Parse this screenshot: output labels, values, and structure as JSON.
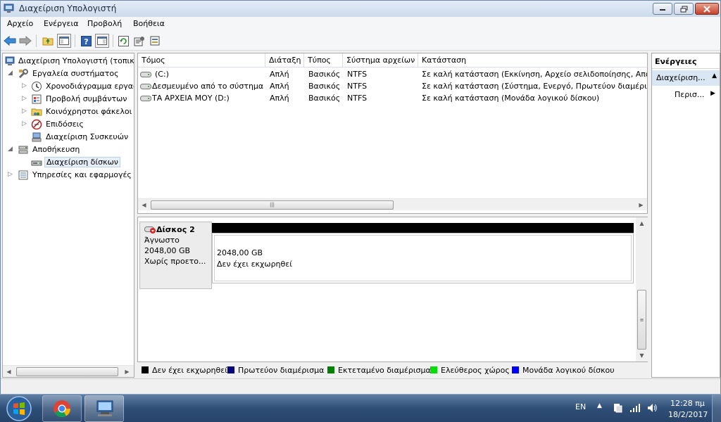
{
  "window": {
    "title": "Διαχείριση Υπολογιστή"
  },
  "menubar": {
    "items": [
      "Αρχείο",
      "Ενέργεια",
      "Προβολή",
      "Βοήθεια"
    ]
  },
  "tree": {
    "root": "Διαχείριση Υπολογιστή (τοπικ",
    "system_tools": "Εργαλεία συστήματος",
    "task_scheduler": "Χρονοδιάγραμμα εργασ",
    "event_viewer": "Προβολή συμβάντων",
    "shared_folders": "Κοινόχρηστοι φάκελοι",
    "performance": "Επιδόσεις",
    "device_manager": "Διαχείριση Συσκευών",
    "storage": "Αποθήκευση",
    "disk_management": "Διαχείριση δίσκων",
    "services": "Υπηρεσίες και εφαρμογές"
  },
  "volumes": {
    "columns": [
      "Τόμος",
      "Διάταξη",
      "Τύπος",
      "Σύστημα αρχείων",
      "Κατάσταση"
    ],
    "rows": [
      {
        "volume": "(C:)",
        "layout": "Απλή",
        "type": "Βασικός",
        "fs": "NTFS",
        "status": "Σε καλή κατάσταση (Εκκίνηση, Αρχείο σελιδοποίησης, Αποτ"
      },
      {
        "volume": "Δεσμευμένο από το σύστημα",
        "layout": "Απλή",
        "type": "Βασικός",
        "fs": "NTFS",
        "status": "Σε καλή κατάσταση (Σύστημα, Ενεργό, Πρωτεύον διαμέρισμ"
      },
      {
        "volume": "ΤΑ ΑΡΧΕΙΑ ΜΟΥ (D:)",
        "layout": "Απλή",
        "type": "Βασικός",
        "fs": "NTFS",
        "status": "Σε καλή κατάσταση (Μονάδα λογικού δίσκου)"
      }
    ]
  },
  "disk": {
    "name": "Δίσκος 2",
    "type": "Άγνωστο",
    "size": "2048,00 GB",
    "state": "Χωρίς προετο...",
    "partition_size": "2048,00 GB",
    "partition_state": "Δεν έχει εκχωρηθεί"
  },
  "legend": {
    "items": [
      {
        "label": "Δεν έχει εκχωρηθεί",
        "color": "#000000"
      },
      {
        "label": "Πρωτεύον διαμέρισμα",
        "color": "#00007b"
      },
      {
        "label": "Εκτεταμένο διαμέρισμα",
        "color": "#008000"
      },
      {
        "label": "Ελεύθερος χώρος",
        "color": "#00e000"
      },
      {
        "label": "Μονάδα λογικού δίσκου",
        "color": "#0000ff"
      }
    ]
  },
  "actions": {
    "title": "Ενέργειες",
    "section": "Διαχείριση...",
    "more": "Περισ..."
  },
  "taskbar": {
    "language": "EN",
    "time": "12:28 πμ",
    "date": "18/2/2017"
  },
  "icons": {
    "title": "computer-management-icon",
    "back": "back-arrow-icon",
    "forward": "forward-arrow-icon",
    "help": "help-icon",
    "refresh": "refresh-icon",
    "start": "windows-start-orb-icon",
    "chrome": "chrome-icon"
  },
  "colors": {
    "unallocated_bar": "#000000",
    "selection": "#e6eef7",
    "actions_header": "#d9e6f4"
  }
}
